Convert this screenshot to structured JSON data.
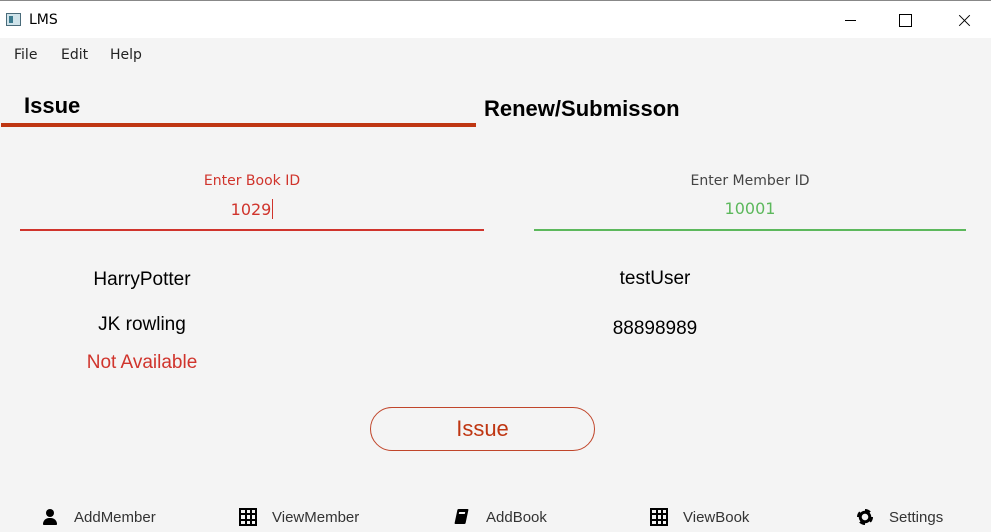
{
  "window": {
    "title": "LMS"
  },
  "menu": {
    "items": [
      "File",
      "Edit",
      "Help"
    ]
  },
  "tabs": [
    {
      "label": "Issue",
      "selected": true
    },
    {
      "label": "Renew/Submisson",
      "selected": false
    }
  ],
  "book_field": {
    "label": "Enter Book ID",
    "value": "1029"
  },
  "member_field": {
    "label": "Enter Member ID",
    "value": "10001"
  },
  "book_info": {
    "name": "HarryPotter",
    "author": "JK rowling",
    "status": "Not Available"
  },
  "member_info": {
    "name": "testUser",
    "phone": "88898989"
  },
  "issue_button": {
    "label": "Issue"
  },
  "bottom_nav": [
    {
      "label": "AddMember",
      "icon": "person-icon"
    },
    {
      "label": "ViewMember",
      "icon": "table-icon"
    },
    {
      "label": "AddBook",
      "icon": "book-icon"
    },
    {
      "label": "ViewBook",
      "icon": "table-icon"
    },
    {
      "label": "Settings",
      "icon": "gear-icon"
    }
  ],
  "colors": {
    "accent": "#bf3612",
    "error": "#d0342c",
    "success": "#5cb85c",
    "background": "#f4f4f4"
  }
}
